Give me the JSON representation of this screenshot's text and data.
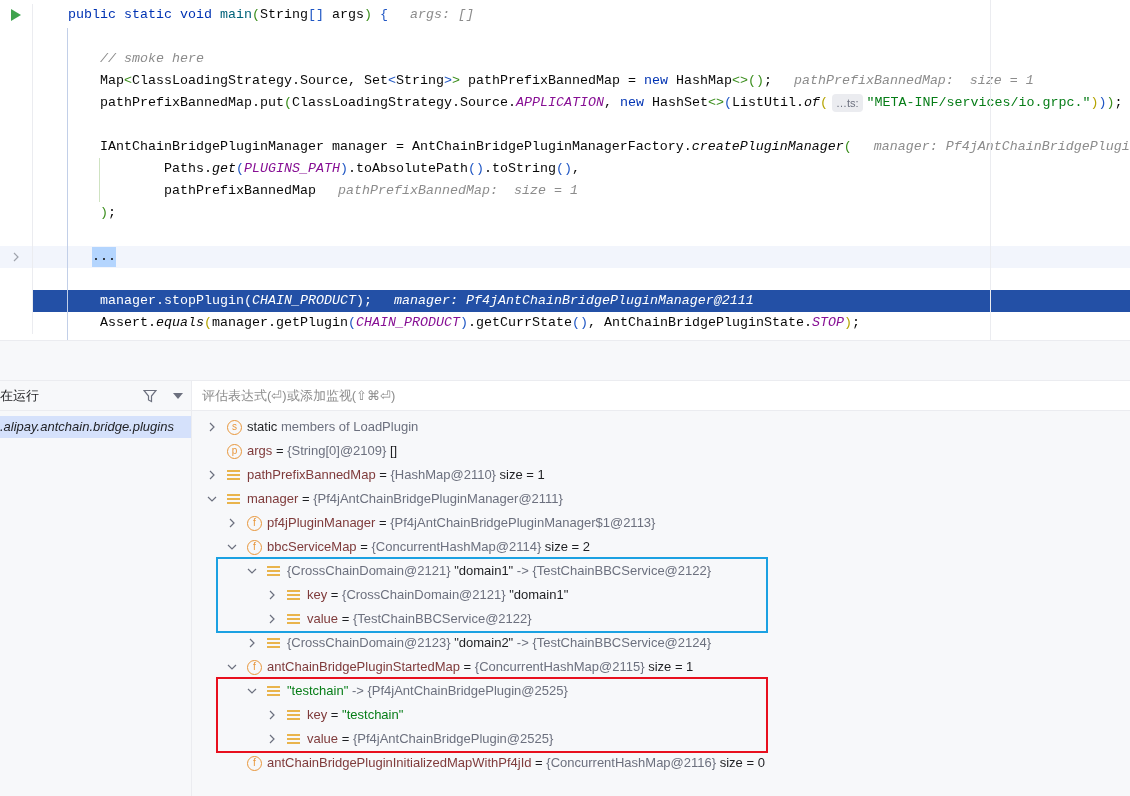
{
  "editor": {
    "lines": [
      {
        "kind": "code",
        "runnable": true,
        "tokens": [
          {
            "kind": "kw",
            "t": "    public static void "
          },
          {
            "kind": "decl",
            "t": "main"
          },
          {
            "kind": "b1",
            "t": "("
          },
          {
            "kind": "id",
            "t": "String"
          },
          {
            "kind": "b2",
            "t": "[]"
          },
          {
            "kind": "id",
            "t": " args"
          },
          {
            "kind": "b1",
            "t": ")"
          },
          {
            "kind": "b2",
            "t": " {"
          },
          {
            "kind": "hint",
            "t": "args: []"
          }
        ]
      },
      {
        "kind": "blank"
      },
      {
        "kind": "code",
        "tokens": [
          {
            "kind": "cm",
            "t": "        // smoke here"
          }
        ]
      },
      {
        "kind": "code",
        "tokens": [
          {
            "kind": "id",
            "t": "        Map"
          },
          {
            "kind": "b1",
            "t": "<"
          },
          {
            "kind": "id",
            "t": "ClassLoadingStrategy.Source, Set"
          },
          {
            "kind": "b2",
            "t": "<"
          },
          {
            "kind": "id",
            "t": "String"
          },
          {
            "kind": "b2",
            "t": ">"
          },
          {
            "kind": "b1",
            "t": ">"
          },
          {
            "kind": "id",
            "t": " pathPrefixBannedMap = "
          },
          {
            "kind": "kw",
            "t": "new"
          },
          {
            "kind": "id",
            "t": " HashMap"
          },
          {
            "kind": "b1",
            "t": "<>()"
          },
          {
            "kind": "id",
            "t": ";"
          },
          {
            "kind": "hint",
            "t": "pathPrefixBannedMap:  size = 1"
          }
        ]
      },
      {
        "kind": "code",
        "tokens": [
          {
            "kind": "id",
            "t": "        pathPrefixBannedMap.put"
          },
          {
            "kind": "b1",
            "t": "("
          },
          {
            "kind": "id",
            "t": "ClassLoadingStrategy.Source."
          },
          {
            "kind": "cst",
            "t": "APPLICATION"
          },
          {
            "kind": "id",
            "t": ", "
          },
          {
            "kind": "kw",
            "t": "new"
          },
          {
            "kind": "id",
            "t": " HashSet"
          },
          {
            "kind": "b1",
            "t": "<>"
          },
          {
            "kind": "b2",
            "t": "("
          },
          {
            "kind": "id",
            "t": "ListUtil."
          },
          {
            "kind": "fn",
            "t": "of"
          },
          {
            "kind": "b3",
            "t": "("
          },
          {
            "kind": "chip",
            "t": "…ts:"
          },
          {
            "kind": "str",
            "t": "\"META-INF/services/io.grpc.\""
          },
          {
            "kind": "b3",
            "t": ")"
          },
          {
            "kind": "b2",
            "t": ")"
          },
          {
            "kind": "b1",
            "t": ")"
          },
          {
            "kind": "id",
            "t": ";"
          }
        ]
      },
      {
        "kind": "blank"
      },
      {
        "kind": "code",
        "tokens": [
          {
            "kind": "id",
            "t": "        IAntChainBridgePluginManager manager = AntChainBridgePluginManagerFactory."
          },
          {
            "kind": "fn",
            "t": "createPluginManager"
          },
          {
            "kind": "b1",
            "t": "("
          },
          {
            "kind": "hint",
            "t": "manager: Pf4jAntChainBridgePlugi"
          }
        ]
      },
      {
        "kind": "code",
        "tokens": [
          {
            "kind": "id",
            "t": "                Paths."
          },
          {
            "kind": "fn",
            "t": "get"
          },
          {
            "kind": "b2",
            "t": "("
          },
          {
            "kind": "cst",
            "t": "PLUGINS_PATH"
          },
          {
            "kind": "b2",
            "t": ")"
          },
          {
            "kind": "id",
            "t": ".toAbsolutePath"
          },
          {
            "kind": "b2",
            "t": "()"
          },
          {
            "kind": "id",
            "t": ".toString"
          },
          {
            "kind": "b2",
            "t": "()"
          },
          {
            "kind": "id",
            "t": ","
          }
        ]
      },
      {
        "kind": "code",
        "tokens": [
          {
            "kind": "id",
            "t": "                pathPrefixBannedMap"
          },
          {
            "kind": "hint",
            "t": "pathPrefixBannedMap:  size = 1"
          }
        ]
      },
      {
        "kind": "code",
        "tokens": [
          {
            "kind": "b1",
            "t": "        )"
          },
          {
            "kind": "id",
            "t": ";"
          }
        ]
      },
      {
        "kind": "blank"
      },
      {
        "kind": "folded",
        "tokens": [
          {
            "kind": "fold",
            "t": "..."
          }
        ]
      },
      {
        "kind": "blank"
      },
      {
        "kind": "current",
        "tokens": [
          {
            "kind": "id",
            "t": "        manager.stopPlugin("
          },
          {
            "kind": "cst",
            "t": "CHAIN_PRODUCT"
          },
          {
            "kind": "id",
            "t": ");"
          },
          {
            "kind": "hint",
            "t": "manager: Pf4jAntChainBridgePluginManager@2111"
          }
        ]
      },
      {
        "kind": "code",
        "tokens": [
          {
            "kind": "id",
            "t": "        Assert."
          },
          {
            "kind": "fn",
            "t": "equals"
          },
          {
            "kind": "b3",
            "t": "("
          },
          {
            "kind": "id",
            "t": "manager.getPlugin"
          },
          {
            "kind": "b2",
            "t": "("
          },
          {
            "kind": "cst",
            "t": "CHAIN_PRODUCT"
          },
          {
            "kind": "b2",
            "t": ")"
          },
          {
            "kind": "id",
            "t": ".getCurrState"
          },
          {
            "kind": "b2",
            "t": "()"
          },
          {
            "kind": "id",
            "t": ", AntChainBridgePluginState."
          },
          {
            "kind": "cst",
            "t": "STOP"
          },
          {
            "kind": "b3",
            "t": ")"
          },
          {
            "kind": "id",
            "t": ";"
          }
        ]
      }
    ]
  },
  "debugger": {
    "frames_header": "在运行",
    "frames": [
      {
        "label": ".alipay.antchain.bridge.plugins",
        "selected": true
      }
    ],
    "evaluate_placeholder": "评估表达式(⏎)或添加监视(⇧⌘⏎)",
    "variables": [
      {
        "kind": "static",
        "badge": "s",
        "expanded": false,
        "parts": [
          {
            "kind": "val",
            "t": "static"
          },
          {
            "kind": "type",
            "t": " members of LoadPlugin"
          }
        ]
      },
      {
        "kind": "param",
        "badge": "p",
        "parts": [
          {
            "kind": "name",
            "t": "args"
          },
          {
            "kind": "val",
            "t": " = "
          },
          {
            "kind": "type",
            "t": "{String[0]@2109}"
          },
          {
            "kind": "val",
            "t": " []"
          }
        ]
      },
      {
        "kind": "entry",
        "expanded": false,
        "parts": [
          {
            "kind": "name",
            "t": "pathPrefixBannedMap"
          },
          {
            "kind": "val",
            "t": " = "
          },
          {
            "kind": "type",
            "t": "{HashMap@2110}"
          },
          {
            "kind": "val",
            "t": "  size = 1"
          }
        ]
      },
      {
        "kind": "entry",
        "expanded": true,
        "parts": [
          {
            "kind": "name",
            "t": "manager"
          },
          {
            "kind": "val",
            "t": " = "
          },
          {
            "kind": "type",
            "t": "{Pf4jAntChainBridgePluginManager@2111}"
          }
        ],
        "children": [
          {
            "kind": "field",
            "badge": "f",
            "expanded": false,
            "parts": [
              {
                "kind": "name",
                "t": "pf4jPluginManager"
              },
              {
                "kind": "val",
                "t": " = "
              },
              {
                "kind": "type",
                "t": "{Pf4jAntChainBridgePluginManager$1@2113}"
              }
            ]
          },
          {
            "kind": "field",
            "badge": "f",
            "expanded": true,
            "parts": [
              {
                "kind": "name",
                "t": "bbcServiceMap"
              },
              {
                "kind": "val",
                "t": " = "
              },
              {
                "kind": "type",
                "t": "{ConcurrentHashMap@2114}"
              },
              {
                "kind": "val",
                "t": "  size = 2"
              }
            ],
            "children": [
              {
                "kind": "entry",
                "expanded": true,
                "color": "#1ba1e2",
                "parts": [
                  {
                    "kind": "type",
                    "t": "{CrossChainDomain@2121}"
                  },
                  {
                    "kind": "val",
                    "t": " \"domain1\""
                  },
                  {
                    "kind": "type",
                    "t": " -> {TestChainBBCService@2122}"
                  }
                ],
                "children": [
                  {
                    "kind": "entry",
                    "expanded": false,
                    "parts": [
                      {
                        "kind": "name",
                        "t": "key"
                      },
                      {
                        "kind": "val",
                        "t": " = "
                      },
                      {
                        "kind": "type",
                        "t": "{CrossChainDomain@2121}"
                      },
                      {
                        "kind": "val",
                        "t": " \"domain1\""
                      }
                    ]
                  },
                  {
                    "kind": "entry",
                    "expanded": false,
                    "parts": [
                      {
                        "kind": "name",
                        "t": "value"
                      },
                      {
                        "kind": "val",
                        "t": " = "
                      },
                      {
                        "kind": "type",
                        "t": "{TestChainBBCService@2122}"
                      }
                    ]
                  }
                ]
              },
              {
                "kind": "entry",
                "expanded": false,
                "parts": [
                  {
                    "kind": "type",
                    "t": "{CrossChainDomain@2123}"
                  },
                  {
                    "kind": "val",
                    "t": " \"domain2\""
                  },
                  {
                    "kind": "type",
                    "t": " -> {TestChainBBCService@2124}"
                  }
                ]
              }
            ]
          },
          {
            "kind": "field",
            "badge": "f",
            "expanded": true,
            "parts": [
              {
                "kind": "name",
                "t": "antChainBridgePluginStartedMap"
              },
              {
                "kind": "val",
                "t": " = "
              },
              {
                "kind": "type",
                "t": "{ConcurrentHashMap@2115}"
              },
              {
                "kind": "val",
                "t": "  size = 1"
              }
            ],
            "children": [
              {
                "kind": "entry",
                "expanded": true,
                "color": "#e8101e",
                "parts": [
                  {
                    "kind": "str",
                    "t": "\"testchain\""
                  },
                  {
                    "kind": "type",
                    "t": " -> {Pf4jAntChainBridgePlugin@2525}"
                  }
                ],
                "children": [
                  {
                    "kind": "entry",
                    "expanded": false,
                    "parts": [
                      {
                        "kind": "name",
                        "t": "key"
                      },
                      {
                        "kind": "val",
                        "t": " = "
                      },
                      {
                        "kind": "str",
                        "t": "\"testchain\""
                      }
                    ]
                  },
                  {
                    "kind": "entry",
                    "expanded": false,
                    "parts": [
                      {
                        "kind": "name",
                        "t": "value"
                      },
                      {
                        "kind": "val",
                        "t": " = "
                      },
                      {
                        "kind": "type",
                        "t": "{Pf4jAntChainBridgePlugin@2525}"
                      }
                    ]
                  }
                ]
              }
            ]
          },
          {
            "kind": "field",
            "badge": "f",
            "parts": [
              {
                "kind": "name",
                "t": "antChainBridgePluginInitializedMapWithPf4jId"
              },
              {
                "kind": "val",
                "t": " = "
              },
              {
                "kind": "type",
                "t": "{ConcurrentHashMap@2116}"
              },
              {
                "kind": "val",
                "t": "  size = 0"
              }
            ]
          }
        ]
      }
    ]
  }
}
